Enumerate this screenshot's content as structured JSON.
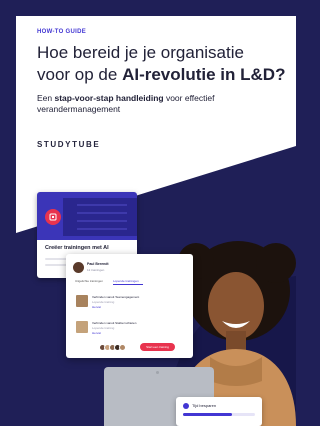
{
  "cover": {
    "kicker": "HOW-TO GUIDE",
    "title_line1": "Hoe bereid je je organisatie",
    "title_line2_prefix": "voor op de ",
    "title_line2_bold": "AI-revolutie in L&D?",
    "subtitle_prefix": "Een ",
    "subtitle_bold": "stap-voor-stap handleiding",
    "subtitle_suffix": " voor effectief verandermanagement",
    "logo": "STUDYTUBE"
  },
  "card_ai": {
    "label": "Creëer trainingen met AI",
    "icon": "training-icon"
  },
  "panel": {
    "user_name": "Paul Berendt",
    "user_meta": "12 trainingen",
    "tab_active_left": "Uitgelichte trainingen",
    "tab_active": "Lopende trainingen",
    "items": [
      {
        "title": "Verbinden vanuit Teamengagement",
        "sub": "Lopende training",
        "link": "Hervat"
      },
      {
        "title": "Verbinden vanuit Stabiel schieten",
        "sub": "Lopende training",
        "link": "Hervat"
      }
    ],
    "cta": "Start een training"
  },
  "progress_card": {
    "label": "Tijd besparen",
    "value": 0.68
  },
  "colors": {
    "navy": "#1f1f57",
    "brand_purple": "#4236d3",
    "accent_red": "#e8334e",
    "white": "#ffffff"
  }
}
